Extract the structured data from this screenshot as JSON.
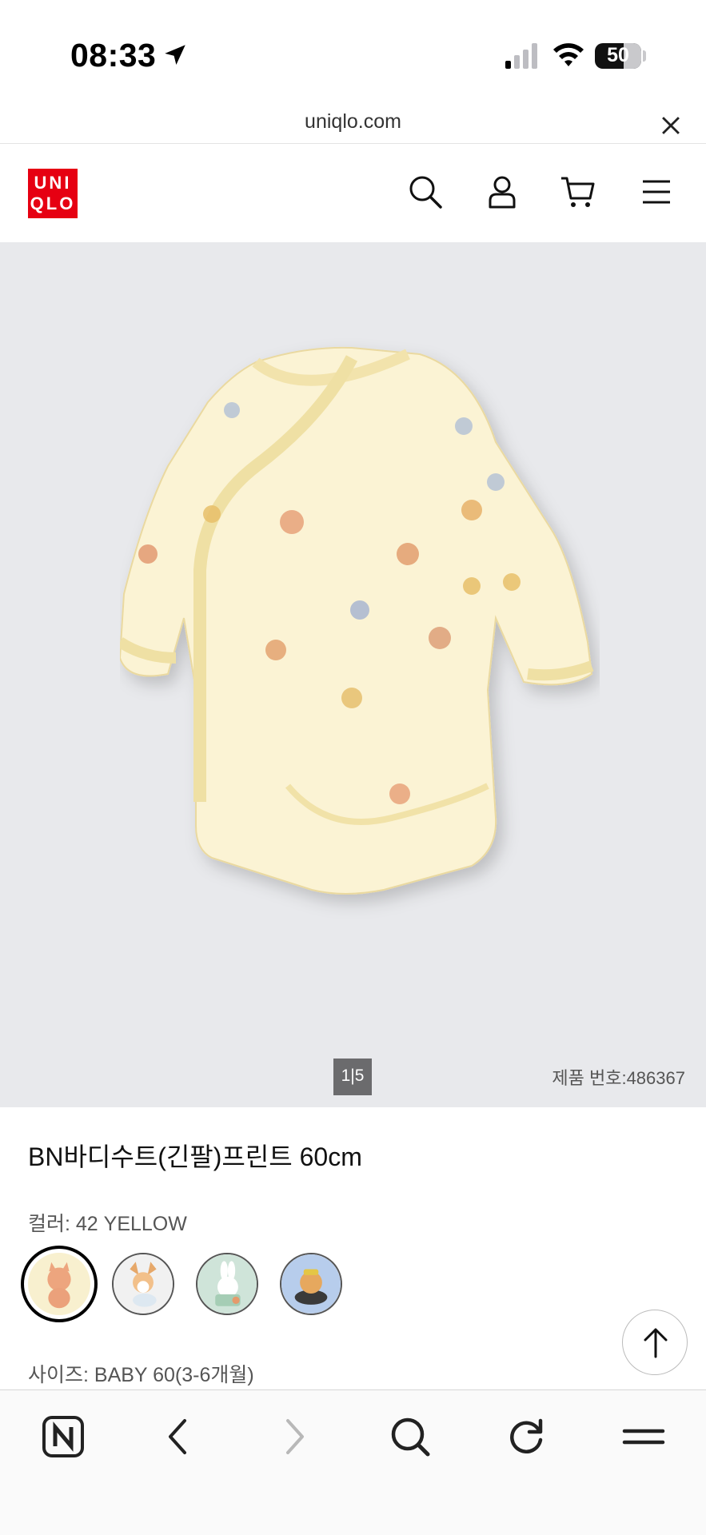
{
  "status_bar": {
    "time": "08:33",
    "battery": "50",
    "icons": [
      "location-arrow-icon",
      "cellular-signal-icon",
      "wifi-icon",
      "battery-icon"
    ]
  },
  "url_bar": {
    "url": "uniqlo.com",
    "close_icon": "close-icon"
  },
  "header": {
    "logo_line1": "UNI",
    "logo_line2": "QLO",
    "brand_color": "#e60012",
    "icons": [
      "search-icon",
      "account-icon",
      "cart-icon",
      "menu-icon"
    ]
  },
  "gallery": {
    "pager_current": "1",
    "pager_total": "5",
    "product_number": "제품 번호:486367",
    "background": "#e8e9ec"
  },
  "product": {
    "title": "BN바디수트(긴팔)프린트 60cm",
    "color_label": "컬러: 42 YELLOW",
    "size_label": "사이즈: BABY 60(3-6개월)",
    "swatches": [
      {
        "name": "cat-print-yellow",
        "selected": true
      },
      {
        "name": "corgi-print-white",
        "selected": false
      },
      {
        "name": "bunny-print-green",
        "selected": false
      },
      {
        "name": "hamster-print-blue",
        "selected": false
      }
    ]
  },
  "floating": {
    "scroll_top_icon": "arrow-up-icon"
  },
  "bottom_bar": {
    "icons": [
      "naver-home-icon",
      "back-icon",
      "forward-icon",
      "search-icon",
      "reload-icon",
      "menu-icon"
    ]
  }
}
